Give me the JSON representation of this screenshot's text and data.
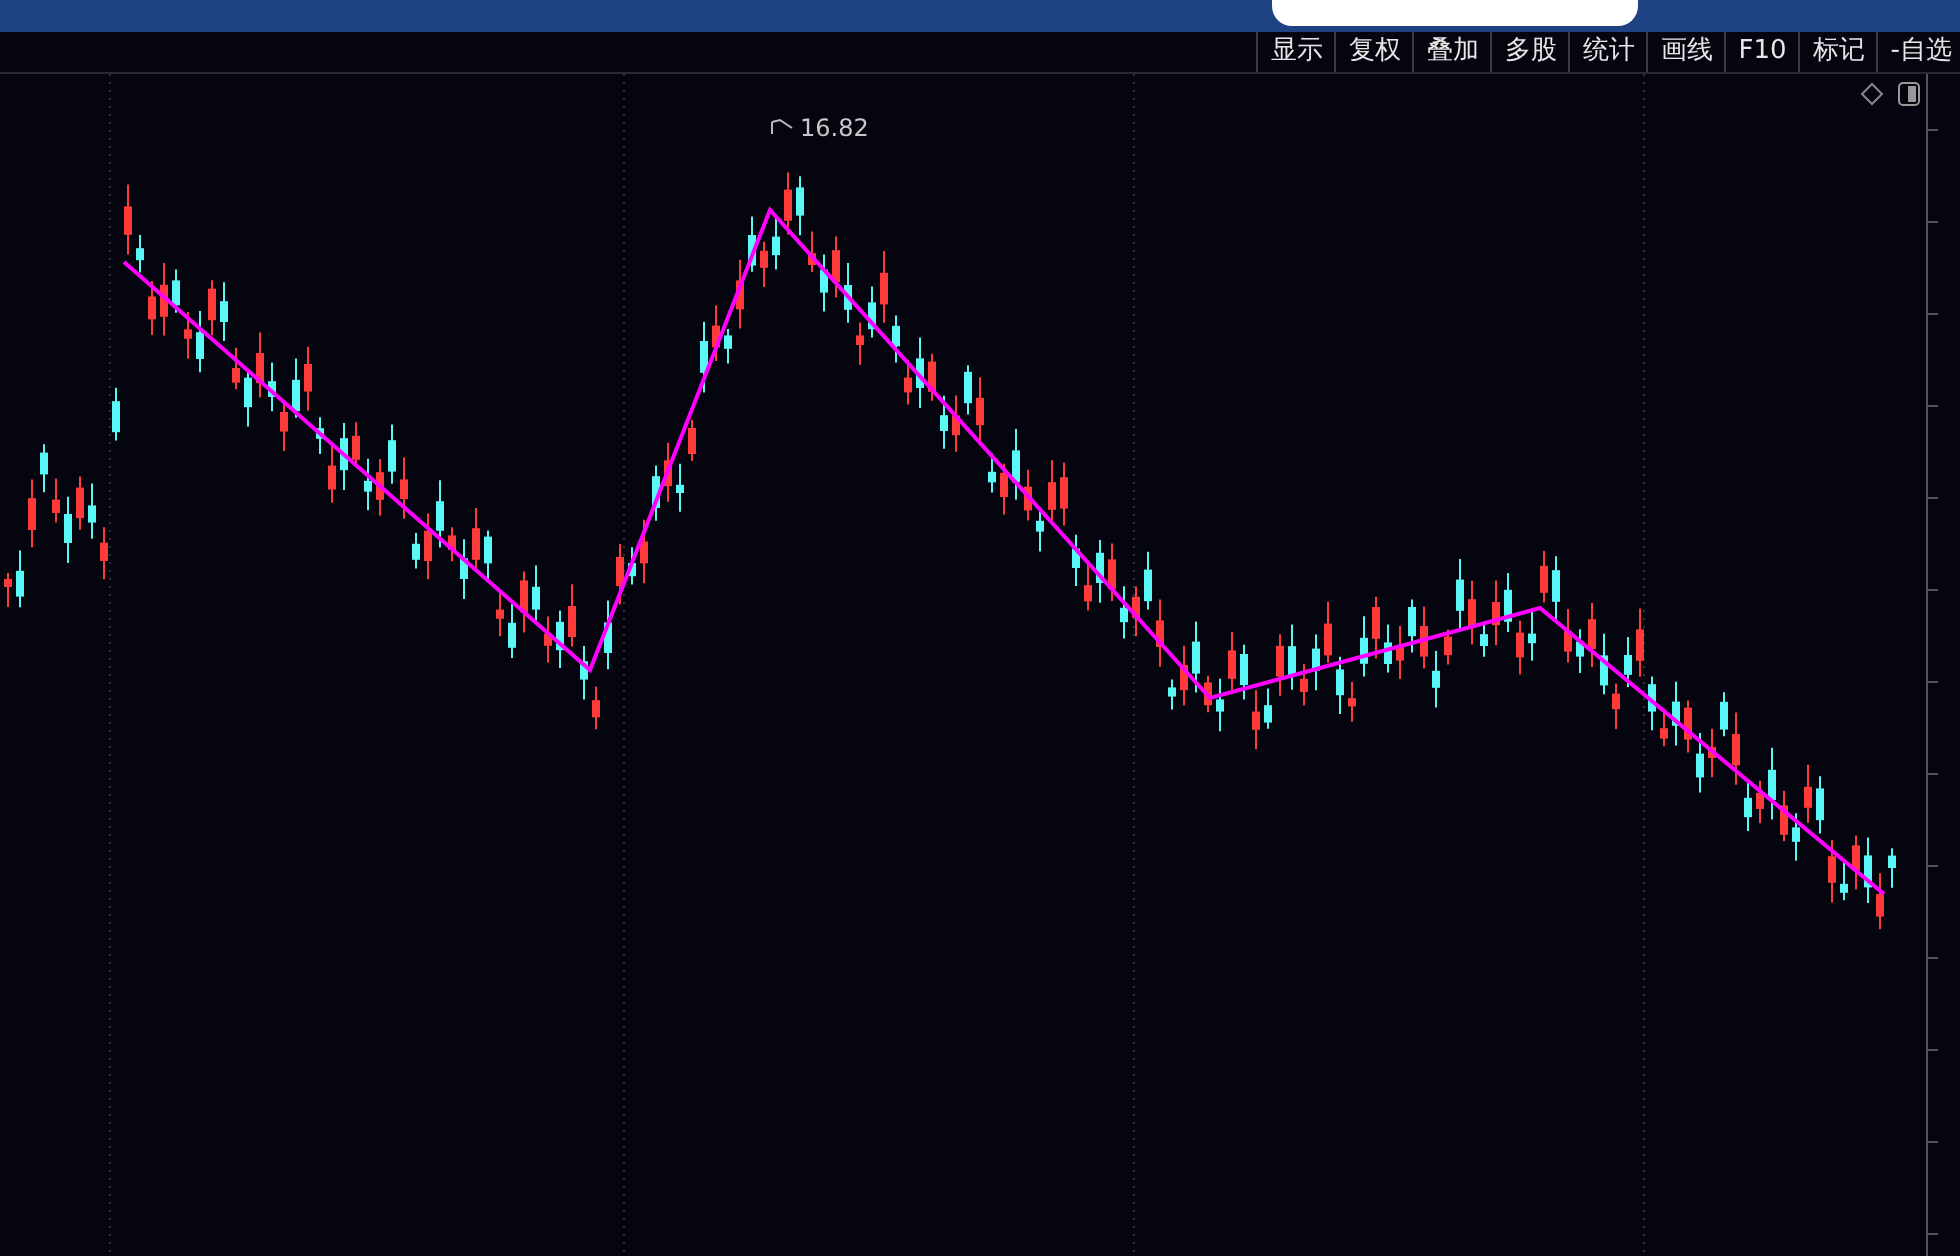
{
  "toolbar": {
    "buttons": [
      {
        "label": "显示"
      },
      {
        "label": "复权"
      },
      {
        "label": "叠加"
      },
      {
        "label": "多股"
      },
      {
        "label": "统计"
      },
      {
        "label": "画线"
      },
      {
        "label": "F10"
      },
      {
        "label": "标记"
      },
      {
        "label": "-自选"
      }
    ]
  },
  "chart": {
    "high_label": "16.82"
  }
}
